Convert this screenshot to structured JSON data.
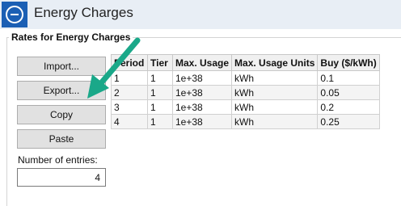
{
  "window": {
    "title": "Energy Charges"
  },
  "group": {
    "title": "Rates for Energy Charges"
  },
  "buttons": {
    "import": "Import...",
    "export": "Export...",
    "copy": "Copy",
    "paste": "Paste"
  },
  "entries": {
    "label": "Number of entries:",
    "value": "4"
  },
  "table": {
    "headers": [
      "Period",
      "Tier",
      "Max. Usage",
      "Max. Usage Units",
      "Buy ($/kWh)"
    ],
    "rows": [
      [
        "1",
        "1",
        "1e+38",
        "kWh",
        "0.1"
      ],
      [
        "2",
        "1",
        "1e+38",
        "kWh",
        "0.05"
      ],
      [
        "3",
        "1",
        "1e+38",
        "kWh",
        "0.2"
      ],
      [
        "4",
        "1",
        "1e+38",
        "kWh",
        "0.25"
      ]
    ]
  },
  "colors": {
    "accent": "#1b5fb4",
    "annotation_arrow": "#1aa889"
  },
  "icons": {
    "back": "back-icon",
    "annotation": "arrow-annotation"
  }
}
